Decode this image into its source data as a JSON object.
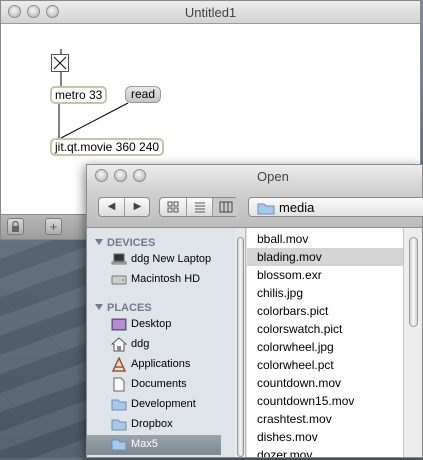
{
  "patcher": {
    "title": "Untitled1",
    "objects": {
      "metro": "metro 33",
      "read": "read",
      "movie": "jit.qt.movie 360 240"
    }
  },
  "dialog": {
    "title": "Open",
    "path": "media",
    "sidebar": {
      "devices_header": "DEVICES",
      "places_header": "PLACES",
      "devices": [
        "ddg New Laptop",
        "Macintosh HD"
      ],
      "places": [
        "Desktop",
        "ddg",
        "Applications",
        "Documents",
        "Development",
        "Dropbox",
        "Max5"
      ],
      "selected": "Max5"
    },
    "files": [
      "bball.mov",
      "blading.mov",
      "blossom.exr",
      "chilis.jpg",
      "colorbars.pict",
      "colorswatch.pict",
      "colorwheel.jpg",
      "colorwheel.pct",
      "countdown.mov",
      "countdown15.mov",
      "crashtest.mov",
      "dishes.mov",
      "dozer.mov"
    ],
    "selected_file": "blading.mov"
  }
}
